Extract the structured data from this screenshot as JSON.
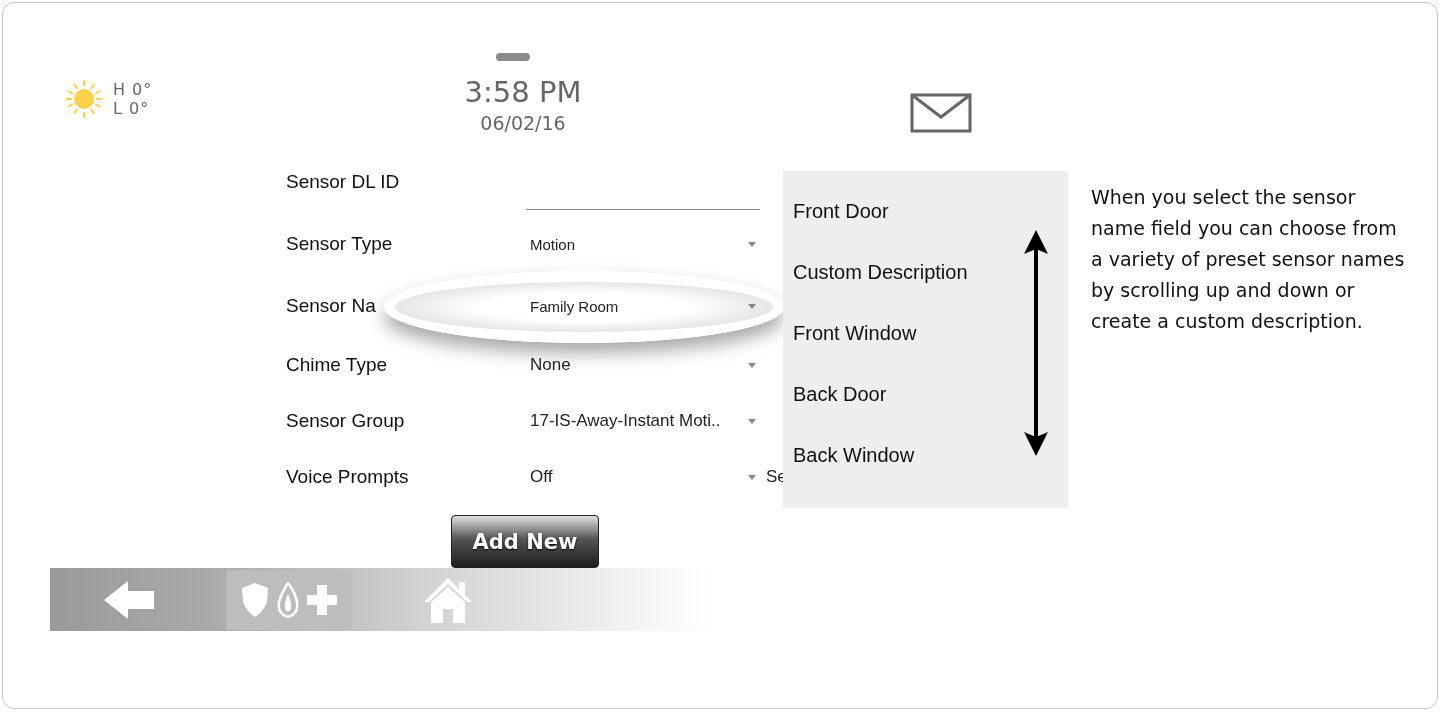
{
  "header": {
    "weather": {
      "high": "H 0°",
      "low": "L 0°"
    },
    "time": "3:58 PM",
    "date": "06/02/16"
  },
  "form": {
    "fields": [
      {
        "kind": "text",
        "label": "Sensor DL ID",
        "highlighted": false
      },
      {
        "kind": "dropdown",
        "label": "Sensor Type",
        "value": "Motion",
        "highlighted": false
      },
      {
        "kind": "dropdown",
        "label": "Sensor Na",
        "value": "Family Room",
        "highlighted": true
      },
      {
        "kind": "dropdown",
        "label": "Chime Type",
        "value": "None",
        "highlighted": false
      },
      {
        "kind": "dropdown",
        "label": "Sensor Group",
        "value": "17-IS-Away-Instant Moti..",
        "highlighted": false
      },
      {
        "kind": "dropdown",
        "label": "Voice Prompts",
        "value": "Off",
        "highlighted": false,
        "trailing": "Se"
      }
    ],
    "button": "Add New"
  },
  "dropdown_list": {
    "options": [
      "Front Door",
      "Custom Description",
      "Front Window",
      "Back Door",
      "Back Window"
    ]
  },
  "description": "When you select the sensor name field you can choose from a variety of preset sensor names by scrolling up and down or create a custom description."
}
